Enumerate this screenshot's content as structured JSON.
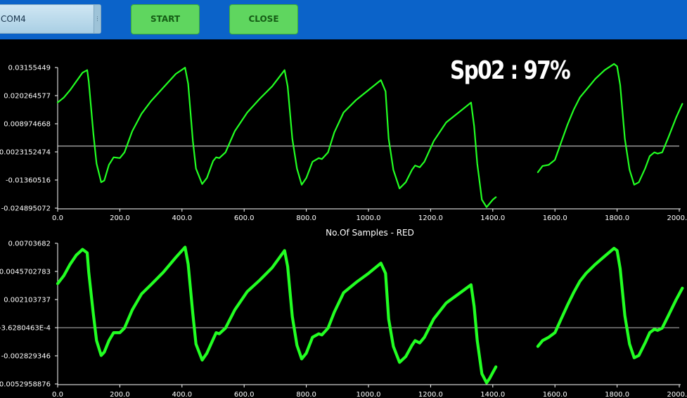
{
  "toolbar": {
    "port_value": "COM4",
    "start_label": "START",
    "close_label": "CLOSE"
  },
  "spo2_text": "Sp02 : 97%",
  "colors": {
    "trace": "#22ff22",
    "toolbar": "#0b63c9",
    "background": "#000000"
  },
  "chart_data": [
    {
      "type": "line",
      "title": "",
      "xlabel": "No.Of Samples  -  RED",
      "ylabel": "",
      "xlim": [
        0,
        2000
      ],
      "ylim": [
        -0.02489507,
        0.03155449
      ],
      "x_ticks": [
        "0.0",
        "200.0",
        "400.0",
        "600.0",
        "800.0",
        "1000.0",
        "1200.0",
        "1400.0",
        "1600.0",
        "1800.0",
        "2000.0"
      ],
      "y_ticks": [
        "0.03155449",
        "0.020264577",
        "0.008974668",
        "-0.0023152474",
        "-0.0136051 6",
        "-0.024895072"
      ],
      "y_tick_values": [
        0.03155449,
        0.020264577,
        0.008974668,
        -0.0023152474,
        -0.01360516,
        -0.024895072
      ],
      "zero_line": 0,
      "series": [
        {
          "x": [
            0,
            20,
            40,
            60,
            80,
            95,
            100,
            115,
            125,
            140,
            150,
            165,
            180,
            200,
            215,
            240,
            270,
            300,
            340,
            380,
            410,
            420,
            435,
            445,
            465,
            480,
            500,
            510,
            520,
            540,
            570,
            610,
            650,
            690,
            730,
            740,
            755,
            770,
            785,
            800,
            820,
            840,
            850,
            870,
            890,
            920,
            960,
            1000,
            1040,
            1055,
            1065,
            1080,
            1100,
            1120,
            1140,
            1150,
            1165,
            1180,
            1210,
            1250,
            1290,
            1330,
            1340,
            1350,
            1365,
            1380,
            1390,
            1400,
            1410
          ],
          "y": [
            0.0175,
            0.0195,
            0.0225,
            0.026,
            0.0295,
            0.0305,
            0.026,
            0.005,
            -0.007,
            -0.0145,
            -0.0138,
            -0.0075,
            -0.0045,
            -0.0048,
            -0.0025,
            0.006,
            0.013,
            0.018,
            0.0235,
            0.029,
            0.0315,
            0.025,
            0.002,
            -0.009,
            -0.0152,
            -0.0128,
            -0.006,
            -0.0045,
            -0.0048,
            -0.0025,
            0.006,
            0.0135,
            0.019,
            0.024,
            0.0305,
            0.024,
            0.003,
            -0.009,
            -0.0155,
            -0.0128,
            -0.0063,
            -0.0048,
            -0.0052,
            -0.0025,
            0.0055,
            0.0135,
            0.0185,
            0.0225,
            0.0265,
            0.022,
            0.003,
            -0.0095,
            -0.017,
            -0.0145,
            -0.0095,
            -0.0078,
            -0.0085,
            -0.0062,
            0.002,
            0.0095,
            0.0135,
            0.0175,
            0.008,
            -0.007,
            -0.0215,
            -0.0245,
            -0.023,
            -0.0215,
            -0.0205
          ],
          "x2": [
            1545,
            1560,
            1580,
            1600,
            1620,
            1640,
            1660,
            1680,
            1700,
            1730,
            1760,
            1790,
            1800,
            1810,
            1825,
            1840,
            1855,
            1870,
            1890,
            1905,
            1920,
            1930,
            1945,
            1965,
            1990,
            2010
          ],
          "y2": [
            -0.0105,
            -0.008,
            -0.0075,
            -0.0055,
            0.0015,
            0.0085,
            0.0145,
            0.0195,
            0.0225,
            0.027,
            0.0305,
            0.033,
            0.032,
            0.0245,
            0.003,
            -0.0095,
            -0.0155,
            -0.0145,
            -0.009,
            -0.004,
            -0.0025,
            -0.003,
            -0.0025,
            0.0035,
            0.0115,
            0.017
          ]
        }
      ]
    },
    {
      "type": "line",
      "title": "",
      "xlabel": "",
      "ylabel": "",
      "xlim": [
        0,
        2000
      ],
      "ylim": [
        -0.0052958876,
        0.00703682
      ],
      "x_ticks": [
        "0.0",
        "200.0",
        "400.0",
        "600.0",
        "800.0",
        "1000.0",
        "1200.0",
        "1400.0",
        "1600.0",
        "1800.0",
        "2000.0"
      ],
      "y_ticks": [
        "0.00703682",
        "0.0045702783",
        "0.002103737",
        "-3.6280463E-4",
        "-0.002829346",
        "-0.0052958876"
      ],
      "y_tick_values": [
        0.00703682,
        0.0045702783,
        0.002103737,
        -0.00036280463,
        -0.002829346,
        -0.0052958876
      ],
      "zero_line": -0.00036280463,
      "series": [
        {
          "x": [
            0,
            20,
            40,
            60,
            80,
            95,
            100,
            115,
            125,
            140,
            150,
            165,
            180,
            200,
            215,
            240,
            270,
            300,
            340,
            380,
            410,
            420,
            435,
            445,
            465,
            480,
            500,
            510,
            520,
            540,
            570,
            610,
            650,
            690,
            730,
            740,
            755,
            770,
            785,
            800,
            820,
            840,
            850,
            870,
            890,
            920,
            960,
            1000,
            1040,
            1055,
            1065,
            1080,
            1100,
            1120,
            1140,
            1150,
            1165,
            1180,
            1210,
            1250,
            1290,
            1330,
            1340,
            1350,
            1365,
            1380,
            1390,
            1400,
            1410
          ],
          "y": [
            0.0035,
            0.0042,
            0.0052,
            0.006,
            0.0065,
            0.0062,
            0.0045,
            0.0008,
            -0.0015,
            -0.0028,
            -0.0025,
            -0.0015,
            -0.0008,
            -0.0008,
            -0.0004,
            0.0012,
            0.0026,
            0.0034,
            0.0045,
            0.0058,
            0.0067,
            0.0052,
            0.0008,
            -0.0018,
            -0.0032,
            -0.0026,
            -0.0014,
            -0.0008,
            -0.0009,
            -0.0004,
            0.0012,
            0.0028,
            0.0038,
            0.0049,
            0.0064,
            0.005,
            0.0006,
            -0.0019,
            -0.0031,
            -0.0026,
            -0.0012,
            -0.0009,
            -0.001,
            -0.0004,
            0.001,
            0.0027,
            0.0036,
            0.0044,
            0.0053,
            0.0044,
            0.0004,
            -0.002,
            -0.0034,
            -0.0029,
            -0.0019,
            -0.0015,
            -0.0017,
            -0.0012,
            0.0004,
            0.0018,
            0.0026,
            0.0034,
            0.0015,
            -0.0015,
            -0.0044,
            -0.0052,
            -0.0048,
            -0.0043,
            -0.0038
          ],
          "x2": [
            1545,
            1560,
            1580,
            1600,
            1620,
            1640,
            1660,
            1680,
            1700,
            1730,
            1760,
            1790,
            1800,
            1810,
            1825,
            1840,
            1855,
            1870,
            1890,
            1905,
            1920,
            1930,
            1945,
            1965,
            1990,
            2010
          ],
          "y2": [
            -0.002,
            -0.0015,
            -0.0012,
            -0.0008,
            0.0004,
            0.0016,
            0.0027,
            0.0037,
            0.0044,
            0.0052,
            0.0059,
            0.0066,
            0.0064,
            0.0048,
            0.0007,
            -0.0018,
            -0.003,
            -0.0028,
            -0.0017,
            -0.0008,
            -0.0005,
            -0.0006,
            -0.0004,
            0.0007,
            0.0021,
            0.0031
          ]
        }
      ]
    }
  ]
}
